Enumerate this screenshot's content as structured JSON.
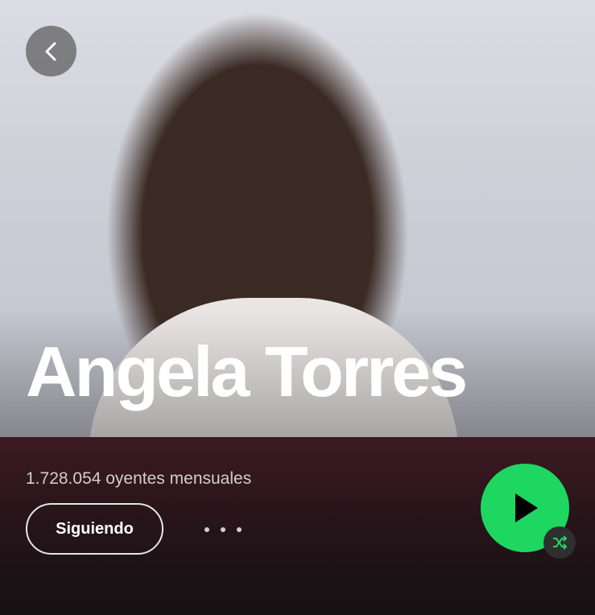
{
  "artist": {
    "name": "Angela Torres",
    "monthly_listeners": "1.728.054 oyentes mensuales"
  },
  "actions": {
    "follow_label": "Siguiendo",
    "more_icon": "more-horizontal-icon",
    "play_icon": "play-icon",
    "shuffle_icon": "shuffle-icon",
    "back_icon": "chevron-left-icon"
  },
  "colors": {
    "accent": "#1ed760",
    "background": "#121212",
    "header_tint": "#3d1a22"
  }
}
